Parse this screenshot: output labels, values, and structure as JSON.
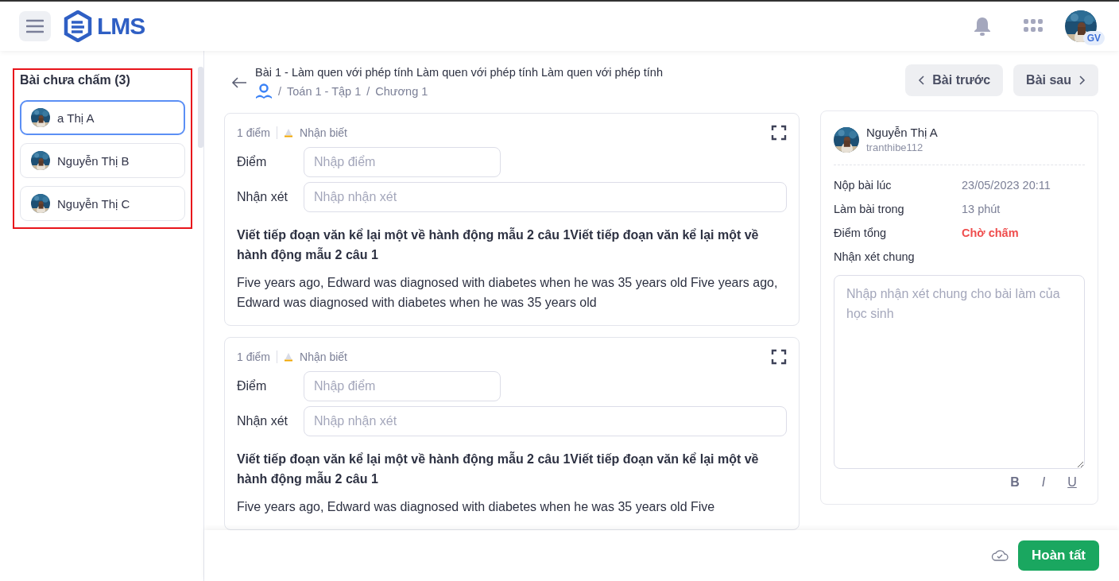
{
  "header": {
    "logo": "LMS",
    "user_badge": "GV"
  },
  "sidebar": {
    "title": "Bài chưa chấm (3)",
    "highlighted": true,
    "items": [
      {
        "name": "a Thị A",
        "selected": true
      },
      {
        "name": "Nguyễn Thị B",
        "selected": false
      },
      {
        "name": "Nguyễn Thị C",
        "selected": false
      }
    ]
  },
  "lesson": {
    "title": "Bài 1 - Làm quen với phép tính Làm quen với phép tính Làm quen với phép tính",
    "breadcrumb": [
      {
        "separator": "/",
        "text": "Toán 1 - Tập 1"
      },
      {
        "separator": "/",
        "text": "Chương 1"
      }
    ],
    "prev_button": "Bài trước",
    "next_button": "Bài sau"
  },
  "questions": [
    {
      "points": "1 điểm",
      "level": "Nhận biết",
      "score_label": "Điểm",
      "score_placeholder": "Nhập điểm",
      "comment_label": "Nhận xét",
      "comment_placeholder": "Nhập nhận xét",
      "question": "Viết tiếp đoạn văn kể lại một về hành động mẫu 2 câu 1Viết tiếp đoạn văn kể lại một về hành động mẫu 2 câu 1",
      "answer": "Five years ago, Edward was diagnosed with diabetes when he was 35 years old Five years ago, Edward was diagnosed with diabetes when he was 35 years old"
    },
    {
      "points": "1 điểm",
      "level": "Nhận biết",
      "score_label": "Điểm",
      "score_placeholder": "Nhập điểm",
      "comment_label": "Nhận xét",
      "comment_placeholder": "Nhập nhận xét",
      "question": "Viết tiếp đoạn văn kể lại một về hành động mẫu 2 câu 1Viết tiếp đoạn văn kể lại một về hành động mẫu 2 câu 1",
      "answer": "Five years ago, Edward was diagnosed with diabetes when he was 35 years old Five"
    }
  ],
  "student": {
    "name": "Nguyễn Thị A",
    "username": "tranthibe112",
    "details": [
      {
        "label": "Nộp bài lúc",
        "value": "23/05/2023 20:11",
        "kind": "plain"
      },
      {
        "label": "Làm bài trong",
        "value": "13 phút",
        "kind": "plain"
      },
      {
        "label": "Điểm tổng",
        "value": "Chờ chấm",
        "kind": "status"
      }
    ],
    "comment_label": "Nhận xét chung",
    "comment_placeholder": "Nhập nhận xét chung cho bài làm của học sinh",
    "format_buttons": [
      "B",
      "I",
      "U"
    ]
  },
  "footer": {
    "finish_button": "Hoàn tất"
  }
}
